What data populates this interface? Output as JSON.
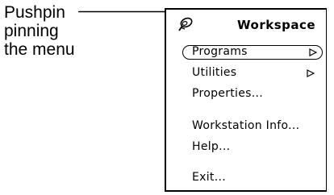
{
  "callout": {
    "lines": [
      "Pushpin",
      "pinning",
      "the menu"
    ]
  },
  "menu": {
    "title": "Workspace",
    "pushpin_icon": "pushpin-icon",
    "items": [
      {
        "label": "Programs",
        "submenu": true,
        "default": true
      },
      {
        "label": "Utilities",
        "submenu": true,
        "default": false
      },
      {
        "label": "Properties...",
        "submenu": false,
        "default": false
      },
      {
        "label": "Workstation Info...",
        "submenu": false,
        "default": false
      },
      {
        "label": "Help...",
        "submenu": false,
        "default": false
      },
      {
        "label": "Exit...",
        "submenu": false,
        "default": false
      }
    ],
    "submenu_icon": "triangle-right-icon"
  },
  "colors": {
    "background": "#ffffff",
    "foreground": "#000000"
  }
}
